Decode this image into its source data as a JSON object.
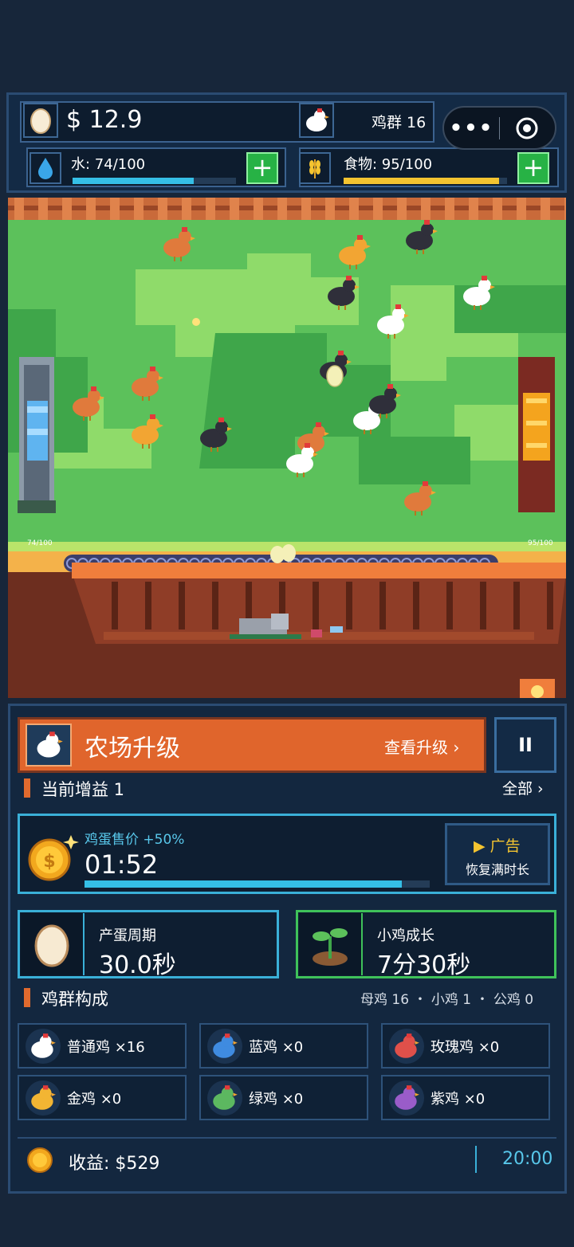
{
  "hud": {
    "money": "$ 12.9",
    "flock_label": "鸡群 16",
    "water_label": "水: 74/100",
    "water_level": 0.74,
    "food_label": "食物: 95/100",
    "food_level": 0.95,
    "add_symbol": "+"
  },
  "capsule": {
    "more_symbol": "•••"
  },
  "farm": {
    "water_trough_label": "74/100",
    "food_trough_label": "95/100"
  },
  "upgrade": {
    "title": "农场升级",
    "action": "查看升级 ›",
    "pause_symbol": "II"
  },
  "buffs": {
    "title": "当前增益 1",
    "all_link": "全部 ›",
    "buff_name": "鸡蛋售价",
    "buff_bonus": "+50%",
    "timer": "01:52",
    "timer_fill": 0.92,
    "ad_button": "▶ 广告",
    "ad_sub": "恢复满时长"
  },
  "stats": {
    "egg_cycle_label": "产蛋周期",
    "egg_cycle_value": "30.0秒",
    "chick_growth_label": "小鸡成长",
    "chick_growth_value": "7分30秒"
  },
  "flock": {
    "title": "鸡群构成",
    "summary": "母鸡 16 ・ 小鸡 1 ・ 公鸡 0",
    "breeds": [
      {
        "label": "普通鸡 ×16",
        "color": "#ffffff"
      },
      {
        "label": "蓝鸡 ×0",
        "color": "#3f8be0"
      },
      {
        "label": "玫瑰鸡 ×0",
        "color": "#e0504a"
      },
      {
        "label": "金鸡 ×0",
        "color": "#f2b533"
      },
      {
        "label": "绿鸡 ×0",
        "color": "#5cb860"
      },
      {
        "label": "紫鸡 ×0",
        "color": "#9a5cc9"
      }
    ]
  },
  "income": {
    "label": "收益: $529",
    "time": "20:00"
  },
  "colors": {
    "accent_orange": "#e0652c",
    "cyan": "#3ab0d8",
    "green": "#3fc25a",
    "water": "#35bfe6",
    "food": "#f4c430"
  }
}
